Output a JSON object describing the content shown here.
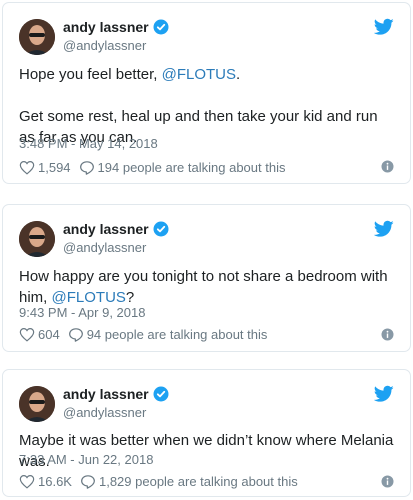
{
  "tweets": [
    {
      "name": "andy lassner",
      "handle": "@andylassner",
      "text_lines": [
        {
          "before": "Hope you feel better, ",
          "mention": "@FLOTUS",
          "after": "."
        },
        {
          "before": "Get some rest, heal up and then take your kid and run as far as you can.",
          "mention": "",
          "after": ""
        }
      ],
      "timestamp": "3:48 PM - May 14, 2018",
      "likes": "1,594",
      "talking": "194 people are talking about this"
    },
    {
      "name": "andy lassner",
      "handle": "@andylassner",
      "text_lines": [
        {
          "before": "How happy are you tonight to not share a bedroom with him, ",
          "mention": "@FLOTUS",
          "after": "?"
        }
      ],
      "timestamp": "9:43 PM - Apr 9, 2018",
      "likes": "604",
      "talking": "94 people are talking about this"
    },
    {
      "name": "andy lassner",
      "handle": "@andylassner",
      "text_lines": [
        {
          "before": "Maybe it was better when we didn’t know where Melania was.",
          "mention": "",
          "after": ""
        }
      ],
      "timestamp": "7:33 AM - Jun 22, 2018",
      "likes": "16.6K",
      "talking": "1,829 people are talking about this"
    }
  ],
  "colors": {
    "link": "#2b7bb9",
    "twitter_blue": "#1da1f2",
    "muted": "#697882",
    "border": "#e1e8ed"
  },
  "icons": {
    "verified": "verified-badge-icon",
    "bird": "twitter-bird-icon",
    "like": "heart-icon",
    "reply": "speech-bubble-icon",
    "info": "info-icon"
  }
}
